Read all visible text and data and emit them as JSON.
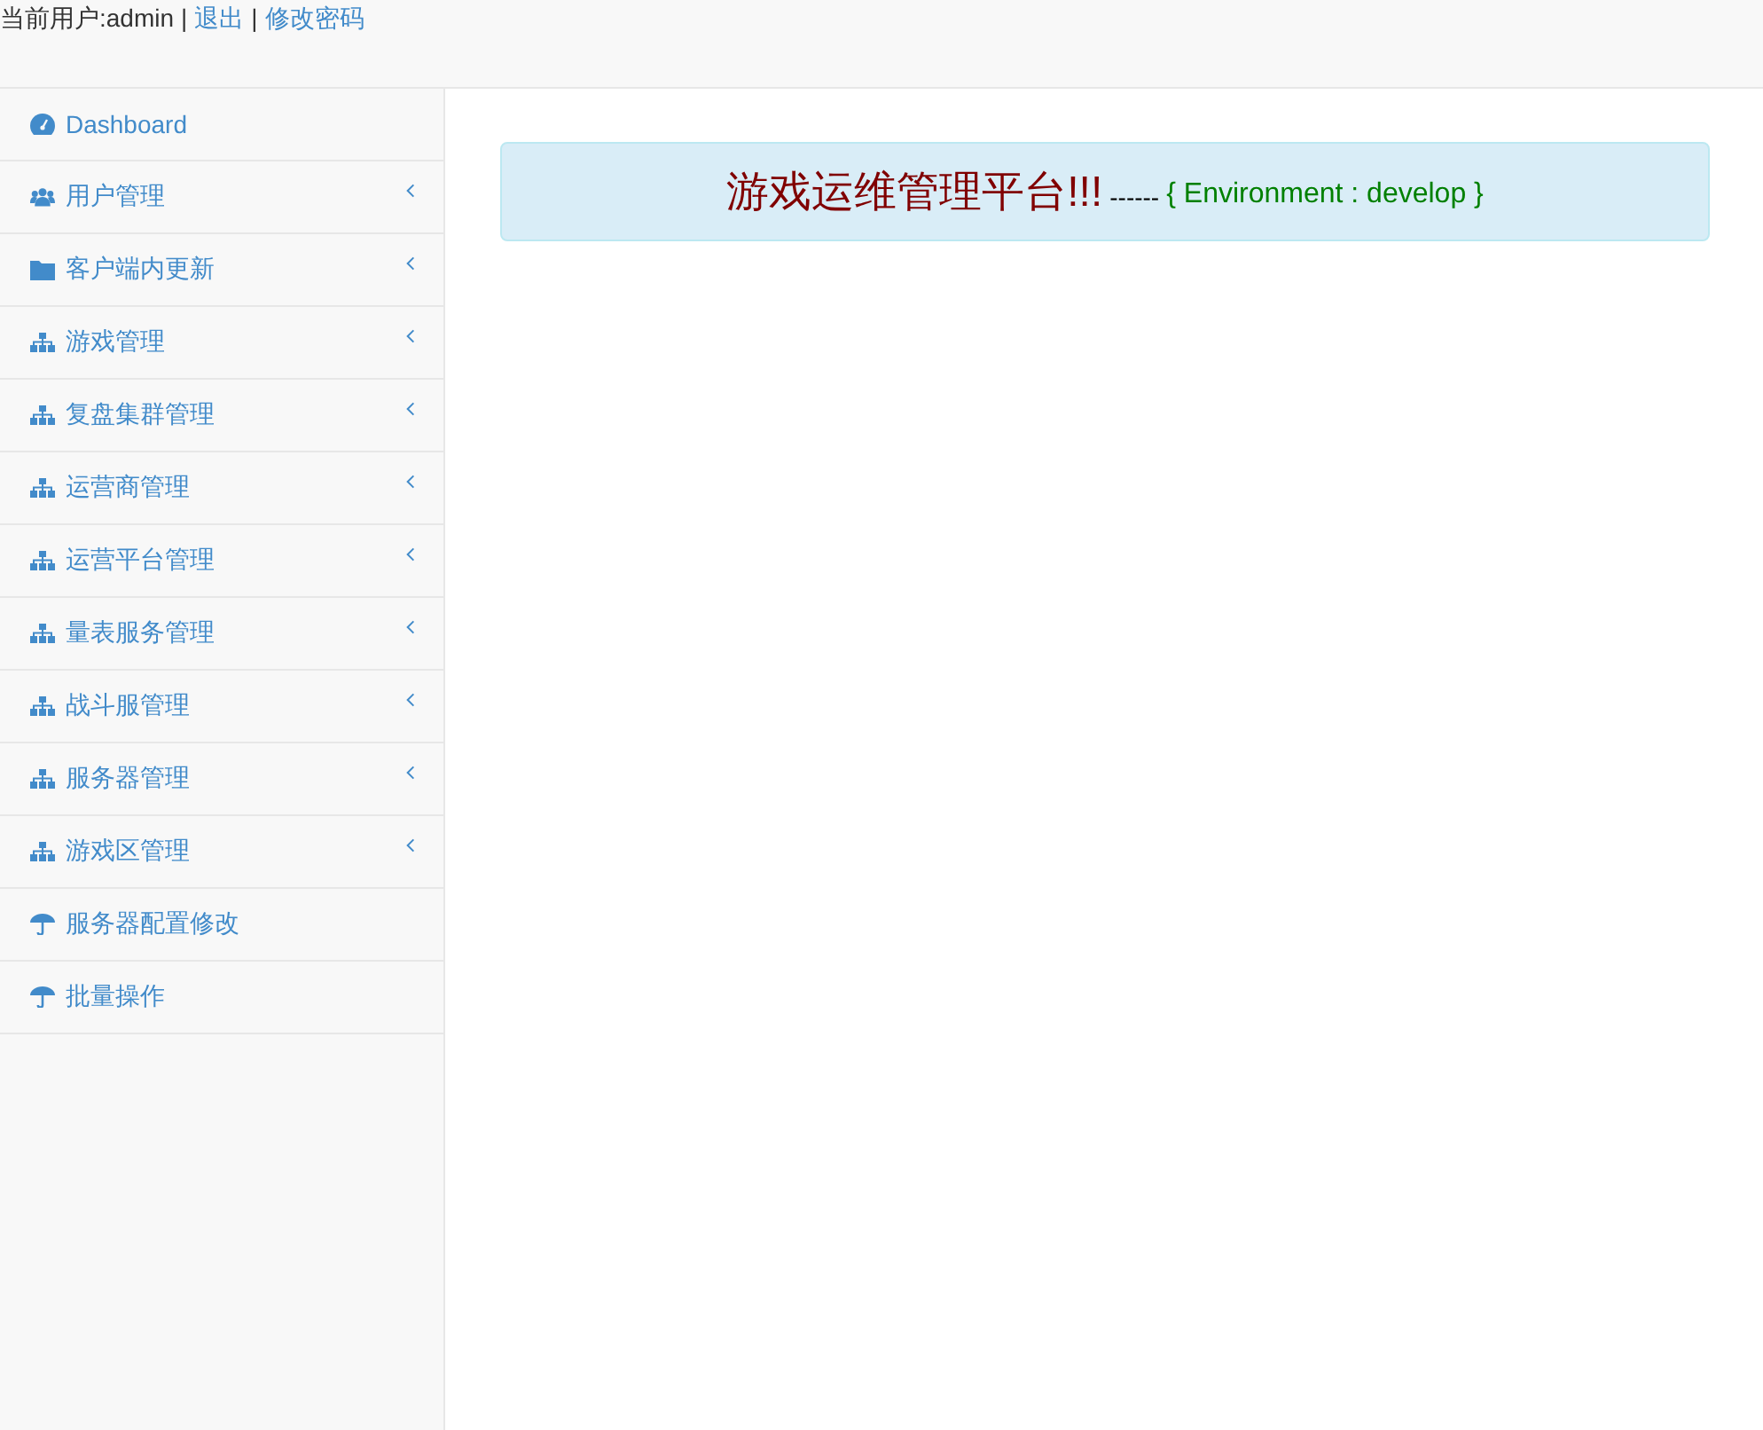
{
  "header": {
    "user_label": "当前用户:admin",
    "separator_1": "|",
    "logout": "退出",
    "separator_2": "|",
    "change_password": "修改密码"
  },
  "sidebar": {
    "items": [
      {
        "label": "Dashboard",
        "kind": "dashboard",
        "expandable": false
      },
      {
        "label": "用户管理",
        "kind": "users",
        "expandable": true
      },
      {
        "label": "客户端内更新",
        "kind": "folder",
        "expandable": true
      },
      {
        "label": "游戏管理",
        "kind": "sitemap",
        "expandable": true
      },
      {
        "label": "复盘集群管理",
        "kind": "sitemap",
        "expandable": true
      },
      {
        "label": "运营商管理",
        "kind": "sitemap",
        "expandable": true
      },
      {
        "label": "运营平台管理",
        "kind": "sitemap",
        "expandable": true
      },
      {
        "label": "量表服务管理",
        "kind": "sitemap",
        "expandable": true
      },
      {
        "label": "战斗服管理",
        "kind": "sitemap",
        "expandable": true
      },
      {
        "label": "服务器管理",
        "kind": "sitemap",
        "expandable": true
      },
      {
        "label": "游戏区管理",
        "kind": "sitemap",
        "expandable": true
      },
      {
        "label": "服务器配置修改",
        "kind": "umbrella",
        "expandable": false
      },
      {
        "label": "批量操作",
        "kind": "umbrella",
        "expandable": false
      }
    ]
  },
  "banner": {
    "title": "游戏运维管理平台!!!",
    "dashes": "------",
    "environment": "{ Environment : develop }"
  }
}
